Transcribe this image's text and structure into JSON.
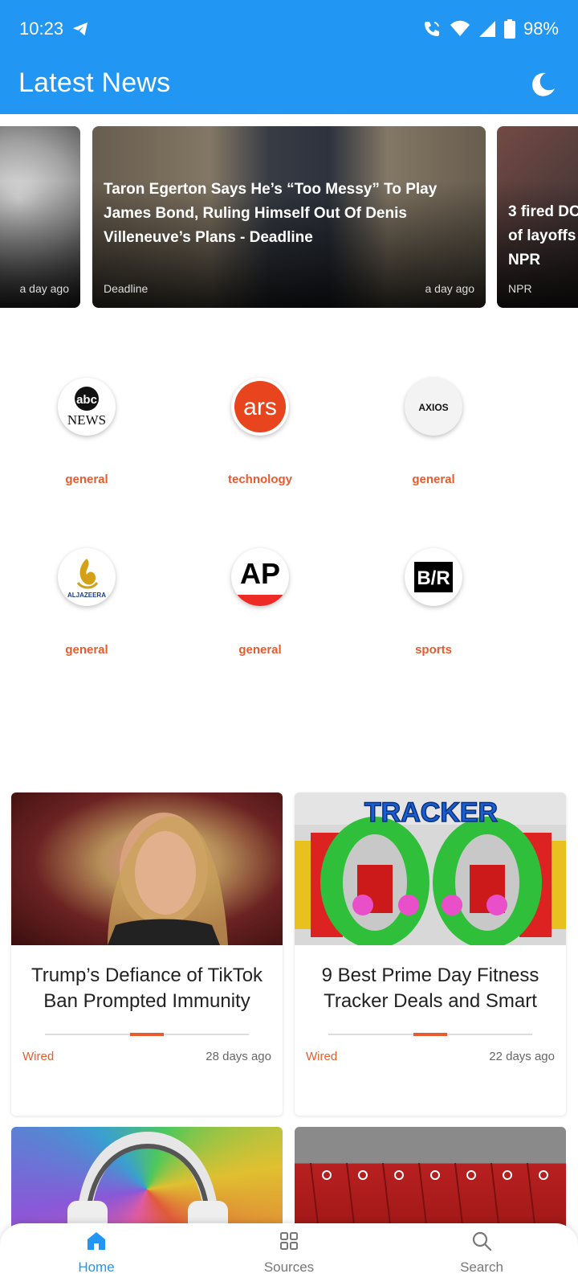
{
  "status_bar": {
    "time": "10:23",
    "battery": "98%"
  },
  "app_bar": {
    "title": "Latest News"
  },
  "carousel": [
    {
      "headline": "",
      "source": "",
      "age": "a day ago"
    },
    {
      "headline": "Taron Egerton Says He’s “Too Messy” To Play James Bond, Ruling Himself Out Of Denis Villeneuve’s Plans - Deadline",
      "source": "Deadline",
      "age": "a day ago"
    },
    {
      "headline": "3 fired DC of layoffs - NPR",
      "source": "NPR",
      "age": ""
    }
  ],
  "sources": [
    {
      "logo_text": "abc NEWS",
      "category": "general"
    },
    {
      "logo_text": "ars",
      "category": "technology"
    },
    {
      "logo_text": "AXIOS",
      "category": "general"
    },
    {
      "logo_text": "ALJAZEERA",
      "category": "general"
    },
    {
      "logo_text": "AP",
      "category": "general"
    },
    {
      "logo_text": "B/R",
      "category": "sports"
    }
  ],
  "articles": [
    {
      "title": "Trump’s Defiance of TikTok Ban Prompted Immunity",
      "source": "Wired",
      "age": "28 days ago"
    },
    {
      "title": "9 Best Prime Day Fitness Tracker Deals and Smart",
      "source": "Wired",
      "age": "22 days ago"
    }
  ],
  "article_images": {
    "tracker_banner": "TRACKER"
  },
  "bottom_nav": [
    {
      "label": "Home",
      "icon": "home-icon"
    },
    {
      "label": "Sources",
      "icon": "grid-icon"
    },
    {
      "label": "Search",
      "icon": "search-icon"
    }
  ],
  "colors": {
    "primary": "#2196f3",
    "accent": "#e65c2e"
  }
}
